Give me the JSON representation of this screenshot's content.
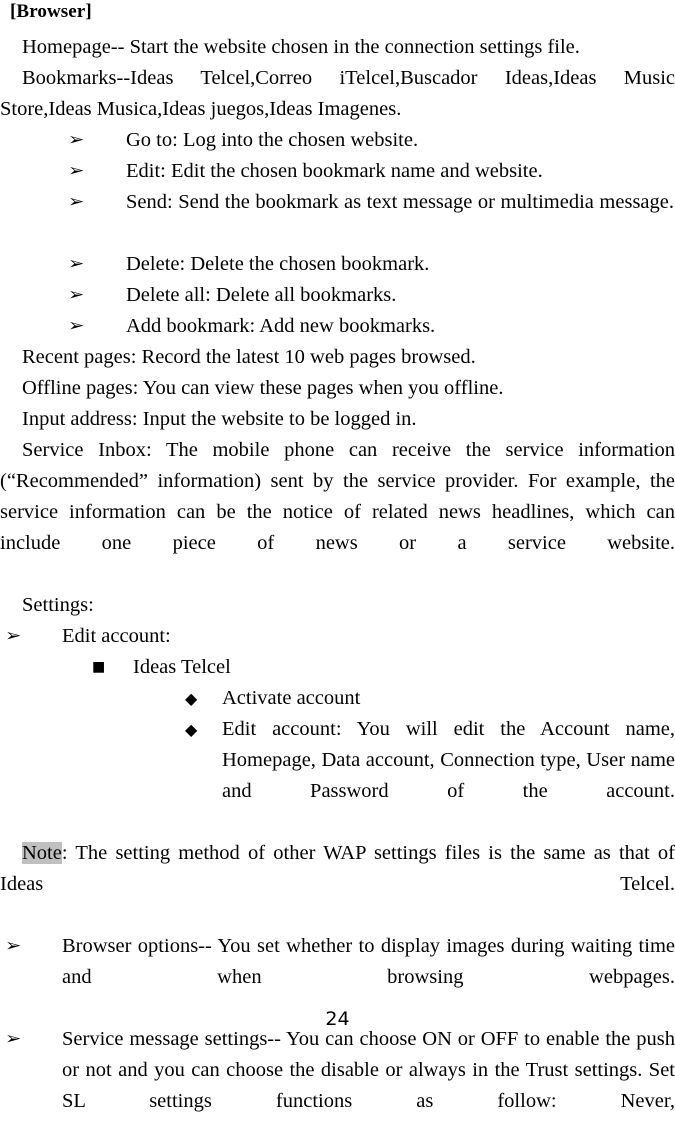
{
  "document": {
    "heading": "[Browser]",
    "page_number": "24",
    "highlight_color": "#c0c0c0",
    "markers": {
      "arrow": "➢",
      "square": "■",
      "diamond": "◆"
    },
    "blocks": {
      "homepage": "Homepage-- Start the website chosen in the connection settings file.",
      "bookmarks": "Bookmarks--Ideas Telcel,Correo iTelcel,Buscador Ideas,Ideas Music Store,Ideas Musica,Ideas juegos,Ideas Imagenes.",
      "recent_pages": "Recent pages: Record the latest 10 web pages browsed.",
      "offline_pages": "Offline pages: You can view these pages when you offline.",
      "input_address": "Input address: Input the website to be logged in.",
      "service_inbox": "Service Inbox: The mobile phone can receive the service information (“Recommended” information) sent by the service provider. For example, the service information can be the notice of related news headlines, which can include one piece of news or a service website.",
      "settings": "Settings:",
      "note_label": "Note",
      "note_text": ": The setting method of other WAP settings files is the same as that of Ideas Telcel."
    },
    "bookmark_actions": [
      "Go to: Log into the chosen website.",
      "Edit: Edit the chosen bookmark name and website.",
      "Send: Send the bookmark as text message or multimedia message.",
      "Delete: Delete the chosen bookmark.",
      "Delete all: Delete all bookmarks.",
      "Add bookmark: Add new bookmarks."
    ],
    "settings_items": {
      "edit_account": "Edit account:",
      "ideas_telcel": "Ideas Telcel",
      "activate_account": "Activate account",
      "edit_account_detail": "Edit account: You will edit the Account name, Homepage, Data account, Connection type, User name and Password of the account.",
      "browser_options": "Browser options-- You set whether to display images during waiting time and when browsing webpages.",
      "service_message_settings": "Service message settings-- You can choose ON or OFF to enable the push or not and you can choose the disable or always in the Trust settings. Set SL settings functions as follow: Never,"
    }
  }
}
